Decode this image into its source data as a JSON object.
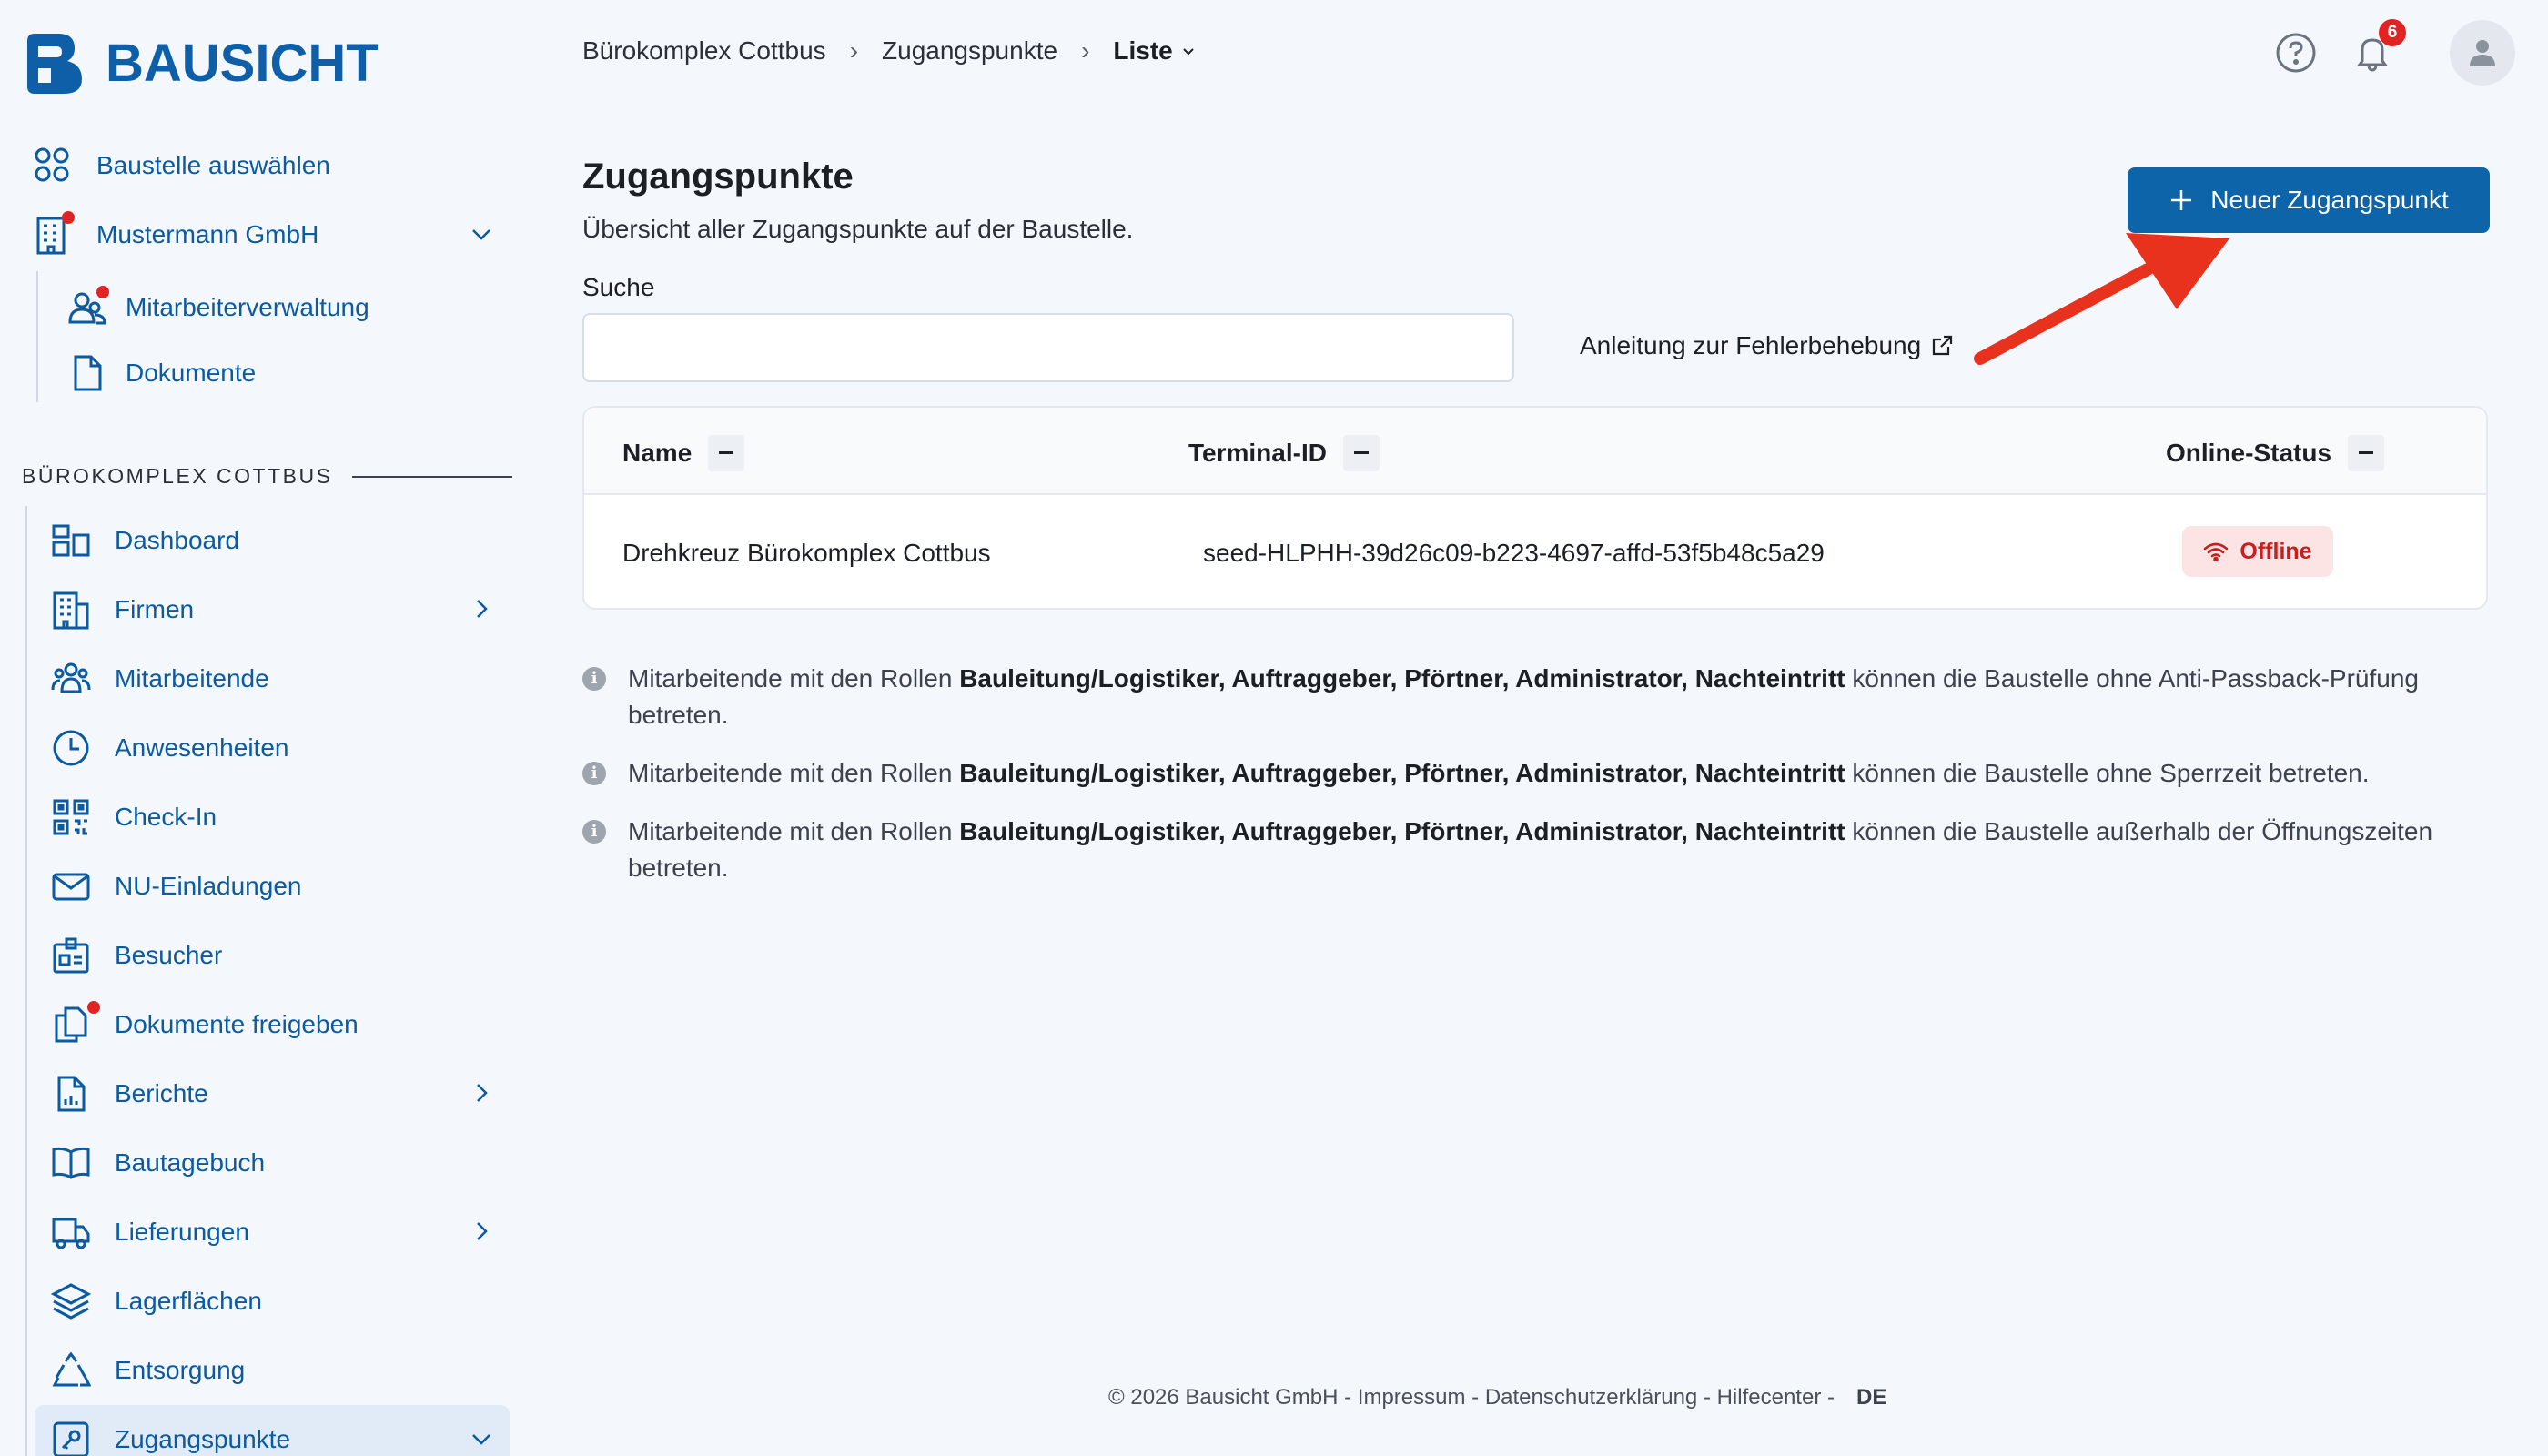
{
  "app": {
    "brand": "BAUSICHT"
  },
  "sidebar": {
    "top_items": [
      {
        "label": "Baustelle auswählen",
        "icon": "grid-icon"
      },
      {
        "label": "Mustermann GmbH",
        "icon": "building-icon"
      },
      {
        "label": "Mitarbeiterverwaltung",
        "icon": "users-icon"
      },
      {
        "label": "Dokumente",
        "icon": "document-icon"
      }
    ],
    "section_title": "BÜROKOMPLEX COTTBUS",
    "items": [
      {
        "label": "Dashboard",
        "icon": "dashboard-icon"
      },
      {
        "label": "Firmen",
        "icon": "office-building-icon"
      },
      {
        "label": "Mitarbeitende",
        "icon": "people-group-icon"
      },
      {
        "label": "Anwesenheiten",
        "icon": "clock-icon"
      },
      {
        "label": "Check-In",
        "icon": "qr-code-icon"
      },
      {
        "label": "NU-Einladungen",
        "icon": "envelope-icon"
      },
      {
        "label": "Besucher",
        "icon": "id-badge-icon"
      },
      {
        "label": "Dokumente freigeben",
        "icon": "documents-icon"
      },
      {
        "label": "Berichte",
        "icon": "report-icon"
      },
      {
        "label": "Bautagebuch",
        "icon": "book-icon"
      },
      {
        "label": "Lieferungen",
        "icon": "truck-icon"
      },
      {
        "label": "Lagerflächen",
        "icon": "layers-icon"
      },
      {
        "label": "Entsorgung",
        "icon": "recycle-icon"
      },
      {
        "label": "Zugangspunkte",
        "icon": "key-icon"
      }
    ]
  },
  "breadcrumb": {
    "items": [
      "Bürokomplex Cottbus",
      "Zugangspunkte"
    ],
    "current": "Liste"
  },
  "topbar": {
    "notifications_count": "6"
  },
  "page": {
    "title": "Zugangspunkte",
    "subtitle": "Übersicht aller Zugangspunkte auf der Baustelle.",
    "new_button": "Neuer Zugangspunkt",
    "search_label": "Suche",
    "search_value": "",
    "help_link": "Anleitung zur Fehlerbehebung"
  },
  "table": {
    "columns": [
      "Name",
      "Terminal-ID",
      "Online-Status"
    ],
    "rows": [
      {
        "name": "Drehkreuz Bürokomplex Cottbus",
        "terminal_id": "seed-HLPHH-39d26c09-b223-4697-affd-53f5b48c5a29",
        "status": "Offline"
      }
    ]
  },
  "info_notes": [
    {
      "prefix": "Mitarbeitende mit den Rollen ",
      "roles": "Bauleitung/Logistiker, Auftraggeber, Pförtner, Administrator, Nachteintritt",
      "suffix": " können die Baustelle ohne Anti-Passback-Prüfung betreten."
    },
    {
      "prefix": "Mitarbeitende mit den Rollen ",
      "roles": "Bauleitung/Logistiker, Auftraggeber, Pförtner, Administrator, Nachteintritt",
      "suffix": " können die Baustelle ohne Sperrzeit betreten."
    },
    {
      "prefix": "Mitarbeitende mit den Rollen ",
      "roles": "Bauleitung/Logistiker, Auftraggeber, Pförtner, Administrator, Nachteintritt",
      "suffix": " können die Baustelle außerhalb der Öffnungszeiten betreten."
    }
  ],
  "footer": {
    "text": "© 2026 Bausicht GmbH - Impressum - Datenschutzerklärung - Hilfecenter -",
    "language": "DE"
  },
  "colors": {
    "primary": "#0e64a8",
    "nav_text": "#0c5aa0",
    "danger": "#e02424",
    "annotation_arrow": "#e8321e"
  }
}
